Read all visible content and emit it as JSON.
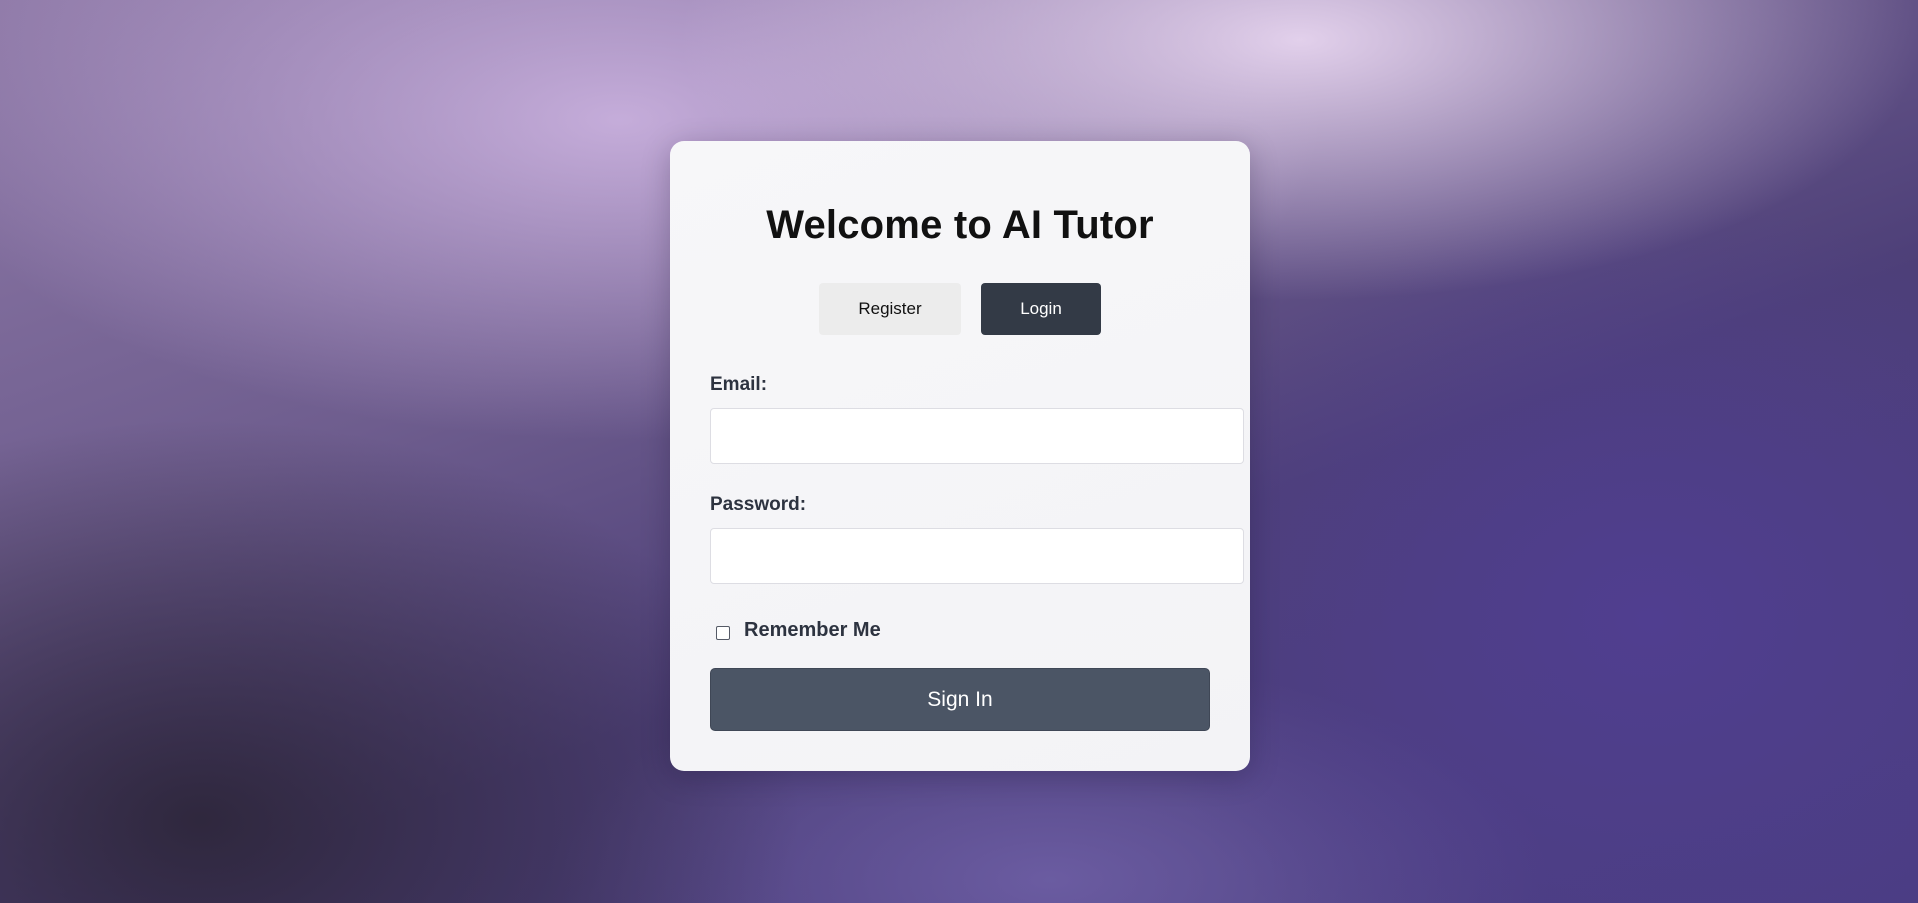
{
  "page": {
    "title": "Welcome to AI Tutor"
  },
  "tabs": {
    "register_label": "Register",
    "login_label": "Login",
    "active": "Login"
  },
  "form": {
    "email_label": "Email:",
    "email_value": "",
    "password_label": "Password:",
    "password_value": "",
    "remember_label": "Remember Me",
    "remember_checked": false,
    "submit_label": "Sign In"
  },
  "colors": {
    "active_tab": "#333a46",
    "inactive_tab": "#ececec",
    "submit_button": "#4b5565",
    "background_accent": "#4a3d82"
  }
}
